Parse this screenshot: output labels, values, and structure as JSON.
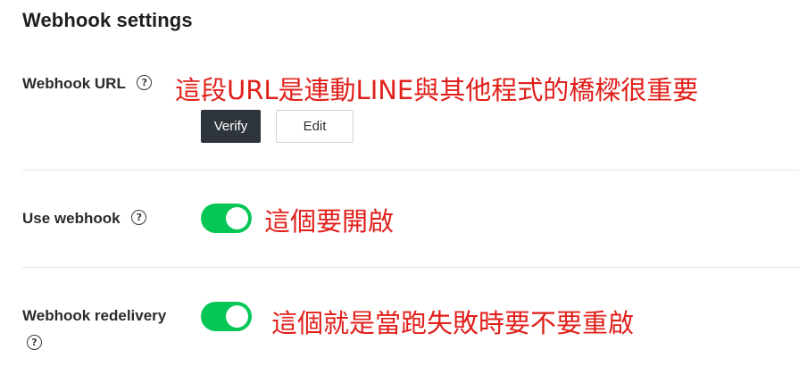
{
  "section": {
    "title": "Webhook settings"
  },
  "webhook_url": {
    "label": "Webhook URL",
    "help_icon": "question-circle-icon",
    "annotation": "這段URL是連動LINE與其他程式的橋樑很重要",
    "verify_label": "Verify",
    "edit_label": "Edit"
  },
  "use_webhook": {
    "label": "Use webhook",
    "help_icon": "question-circle-icon",
    "enabled": true,
    "annotation": "這個要開啟"
  },
  "webhook_redelivery": {
    "label": "Webhook redelivery",
    "help_icon": "question-circle-icon",
    "enabled": true,
    "annotation": "這個就是當跑失敗時要不要重啟"
  },
  "colors": {
    "toggle_on": "#06c755",
    "verify_button": "#2e343b",
    "annotation": "#e0201b"
  }
}
